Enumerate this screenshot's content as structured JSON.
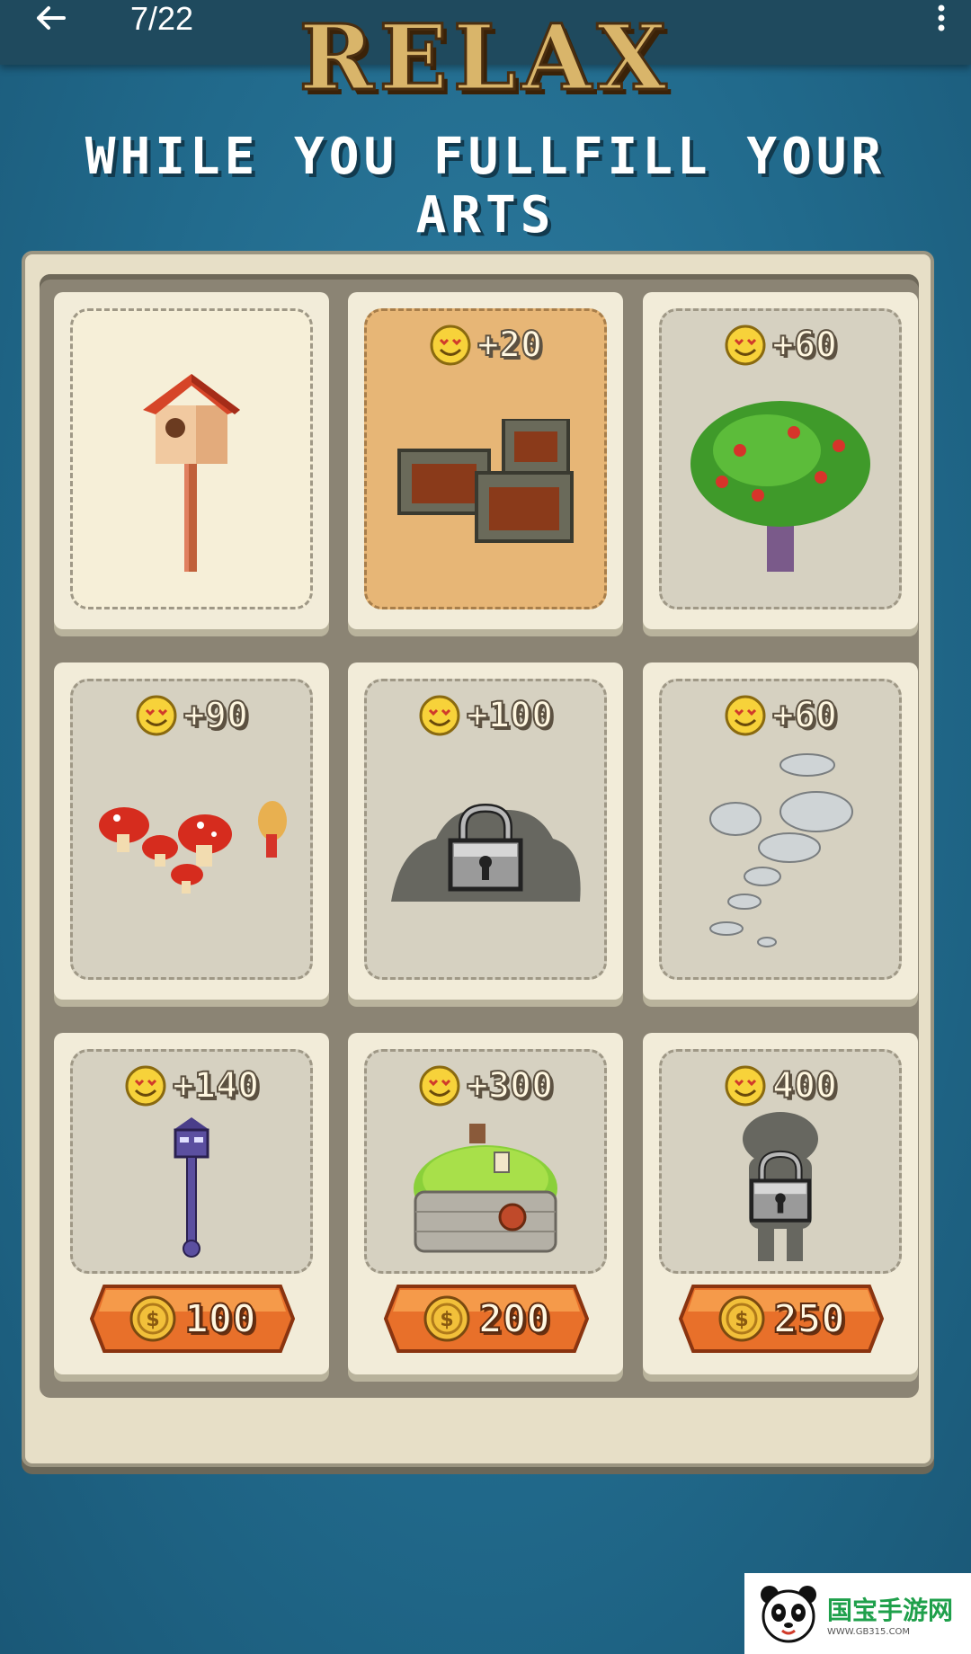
{
  "topbar": {
    "counter": "7/22",
    "back_icon": "arrow-left-icon",
    "more_icon": "more-vertical-icon"
  },
  "header": {
    "title": "RELAX",
    "subtitle": "WHILE YOU FULLFILL YOUR ARTS"
  },
  "cards": [
    {
      "item": "birdhouse",
      "reward": "",
      "locked": false,
      "price": ""
    },
    {
      "item": "crates",
      "reward": "+20",
      "locked": false,
      "price": ""
    },
    {
      "item": "apple-tree",
      "reward": "+60",
      "locked": false,
      "price": ""
    },
    {
      "item": "mushrooms",
      "reward": "+90",
      "locked": false,
      "price": ""
    },
    {
      "item": "bush",
      "reward": "+100",
      "locked": true,
      "price": ""
    },
    {
      "item": "stones",
      "reward": "+60",
      "locked": false,
      "price": ""
    },
    {
      "item": "street-lamp",
      "reward": "+140",
      "locked": false,
      "price": "100"
    },
    {
      "item": "hut",
      "reward": "+300",
      "locked": false,
      "price": "200"
    },
    {
      "item": "figure",
      "reward": "400",
      "locked": true,
      "price": "250"
    }
  ],
  "watermark": {
    "text": "国宝手游网",
    "url": "WWW.GB315.COM"
  },
  "colors": {
    "background": "#216a8c",
    "panel": "#e7dfc7",
    "button": "#e8702a",
    "title": "#d9b56a"
  }
}
